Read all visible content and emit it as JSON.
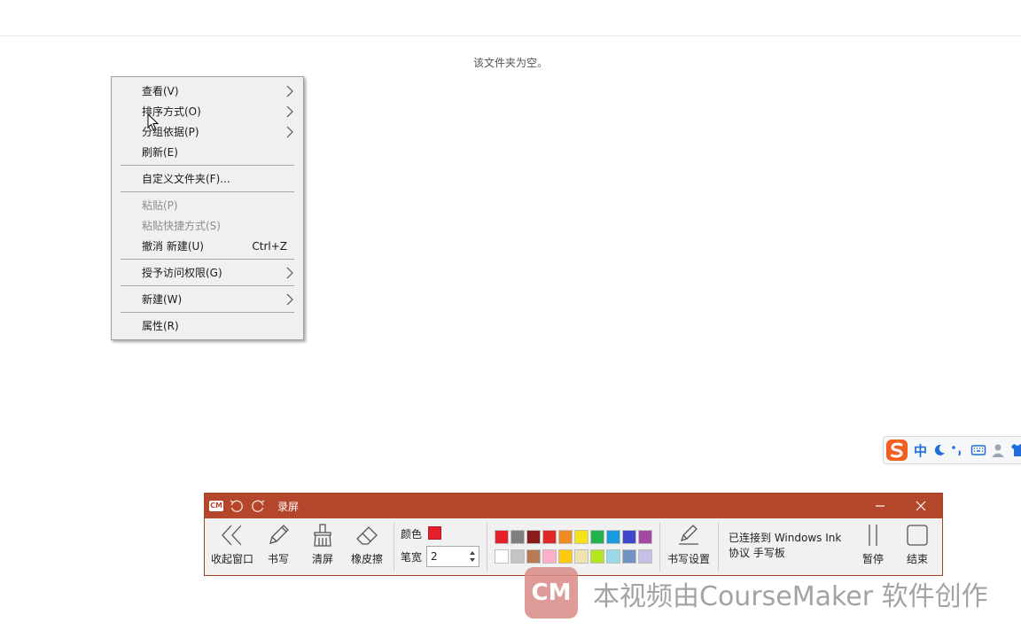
{
  "explorer": {
    "empty_message": "该文件夹为空。"
  },
  "context_menu": {
    "items": [
      {
        "label": "查看(V)",
        "has_submenu": true
      },
      {
        "label": "排序方式(O)",
        "has_submenu": true
      },
      {
        "label": "分组依据(P)",
        "has_submenu": true
      },
      {
        "label": "刷新(E)"
      },
      {
        "label": "自定义文件夹(F)..."
      },
      {
        "label": "粘贴(P)",
        "disabled": true
      },
      {
        "label": "粘贴快捷方式(S)",
        "disabled": true
      },
      {
        "label": "撤消 新建(U)",
        "shortcut": "Ctrl+Z"
      },
      {
        "label": "授予访问权限(G)",
        "has_submenu": true
      },
      {
        "label": "新建(W)",
        "has_submenu": true
      },
      {
        "label": "属性(R)"
      }
    ]
  },
  "ime_toolbar": {
    "mode_label": "中"
  },
  "recorder": {
    "logo": "CM",
    "title": "录屏",
    "tools": {
      "collapse": "收起窗口",
      "write": "书写",
      "clear": "清屏",
      "eraser": "橡皮擦",
      "write_settings": "书写设置",
      "pause": "暂停",
      "end": "结束"
    },
    "color_label": "颜色",
    "current_color": "#e5202a",
    "pen_width_label": "笔宽",
    "pen_width_value": "2",
    "palette_row1": [
      "#e5202a",
      "#7f7f7f",
      "#8b1a1a",
      "#e02828",
      "#f08a24",
      "#f5e31a",
      "#23b14d",
      "#1a9be0",
      "#3f48cc",
      "#a349a4"
    ],
    "palette_row2": [
      "#ffffff",
      "#c3c3c3",
      "#b97a57",
      "#ffaec9",
      "#ffc90e",
      "#efe4b0",
      "#b5e61d",
      "#99d9ea",
      "#7092be",
      "#c8bfe7"
    ],
    "status_line1": "已连接到 Windows Ink",
    "status_line2": "协议 手写板"
  },
  "watermark": {
    "logo": "CM",
    "text": "本视频由CourseMaker 软件创作"
  }
}
